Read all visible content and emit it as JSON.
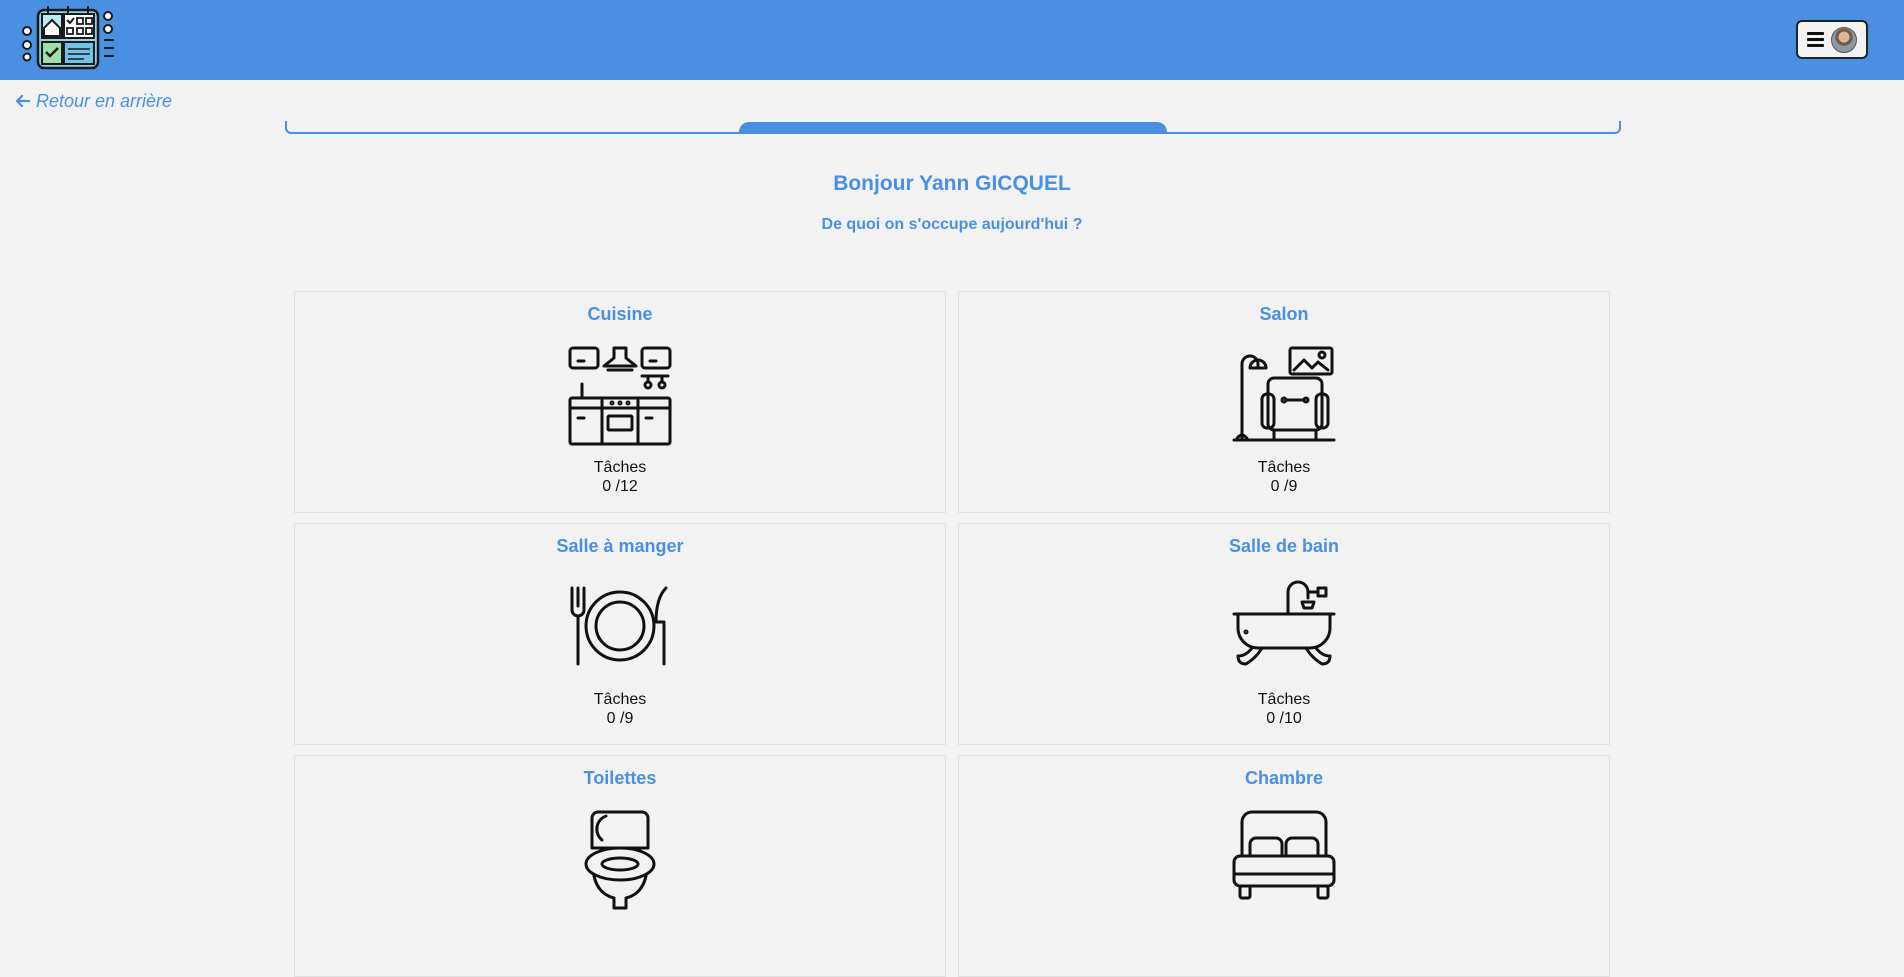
{
  "header": {
    "logo_icon": "checklist-house-logo",
    "menu_icon": "hamburger-icon",
    "accent_color": "#4a90e2"
  },
  "nav": {
    "back_label": "Retour en arrière"
  },
  "stepper": {
    "active_step": 2,
    "total_steps": 3
  },
  "main": {
    "greeting": "Bonjour Yann GICQUEL",
    "subtitle": "De quoi on s'occupe aujourd'hui ?"
  },
  "rooms": [
    {
      "name": "Cuisine",
      "icon": "kitchen-icon",
      "tasks_label": "Tâches",
      "tasks_count": "0 /12"
    },
    {
      "name": "Salon",
      "icon": "armchair-icon",
      "tasks_label": "Tâches",
      "tasks_count": "0 /9"
    },
    {
      "name": "Salle à manger",
      "icon": "plate-cutlery-icon",
      "tasks_label": "Tâches",
      "tasks_count": "0 /9"
    },
    {
      "name": "Salle de bain",
      "icon": "bathtub-icon",
      "tasks_label": "Tâches",
      "tasks_count": "0 /10"
    },
    {
      "name": "Toilettes",
      "icon": "toilet-icon",
      "tasks_label": "",
      "tasks_count": ""
    },
    {
      "name": "Chambre",
      "icon": "bed-icon",
      "tasks_label": "",
      "tasks_count": ""
    }
  ]
}
